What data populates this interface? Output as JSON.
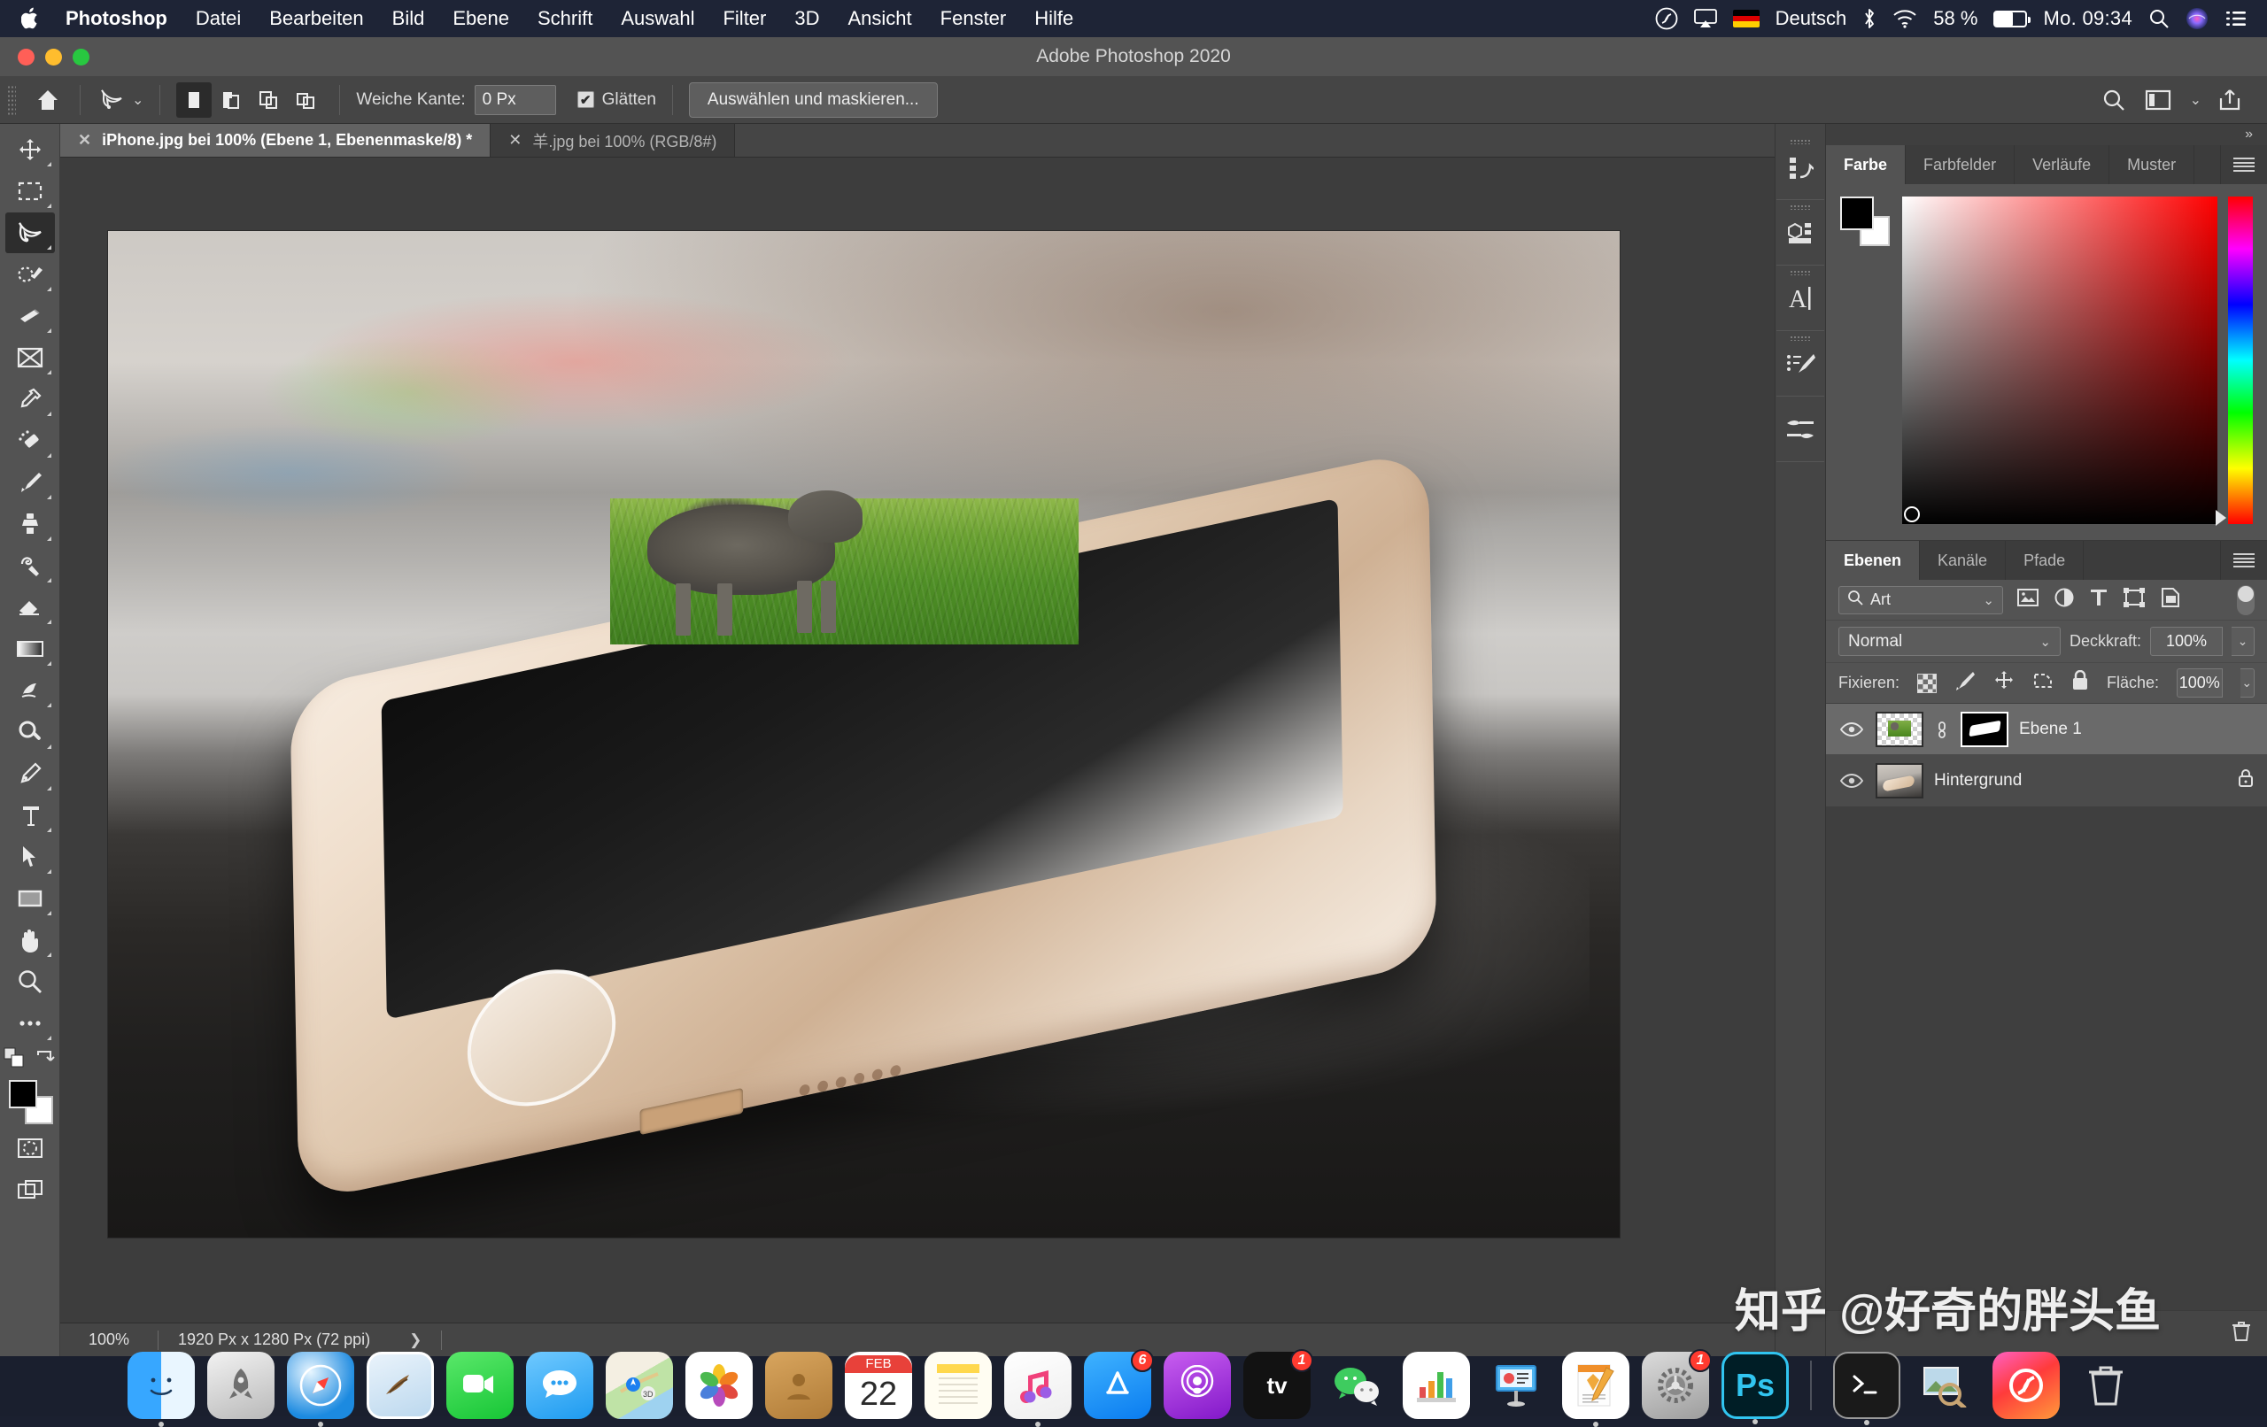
{
  "menubar": {
    "apple_icon": "apple-logo-icon",
    "items": [
      "Photoshop",
      "Datei",
      "Bearbeiten",
      "Bild",
      "Ebene",
      "Schrift",
      "Auswahl",
      "Filter",
      "3D",
      "Ansicht",
      "Fenster",
      "Hilfe"
    ],
    "status": {
      "creative_cloud_icon": "creative-cloud-icon",
      "airplay_icon": "airplay-icon",
      "flag_icon": "german-flag-icon",
      "language": "Deutsch",
      "bluetooth_icon": "bluetooth-icon",
      "wifi_icon": "wifi-icon",
      "battery_percent": "58 %",
      "battery_icon": "battery-icon",
      "clock": "Mo. 09:34",
      "search_icon": "spotlight-search-icon",
      "siri_icon": "siri-icon",
      "control_center_icon": "control-center-icon"
    }
  },
  "window": {
    "title": "Adobe Photoshop 2020",
    "close_label": "",
    "minimize_label": "",
    "zoom_label": ""
  },
  "options_bar": {
    "home_icon": "home-icon",
    "tool_icon": "lasso-tool-icon",
    "tool_preset_chevron": "chevron-down-icon",
    "selection_modes": [
      {
        "name": "new-selection",
        "icon": "new-selection-icon",
        "active": true
      },
      {
        "name": "add-to-selection",
        "icon": "add-selection-icon",
        "active": false
      },
      {
        "name": "subtract-from-selection",
        "icon": "subtract-selection-icon",
        "active": false
      },
      {
        "name": "intersect-selection",
        "icon": "intersect-selection-icon",
        "active": false
      }
    ],
    "feather_label": "Weiche Kante:",
    "feather_value": "0 Px",
    "antialias_label": "Glätten",
    "antialias_checked": true,
    "select_mask_button": "Auswählen und maskieren...",
    "right_icons": [
      "search-icon",
      "workspace-icon",
      "chevron-down-icon",
      "share-icon"
    ]
  },
  "toolbar": {
    "tools": [
      {
        "name": "move-tool",
        "icon": "move-icon",
        "active": false
      },
      {
        "name": "rectangular-marquee-tool",
        "icon": "marquee-icon",
        "active": false
      },
      {
        "name": "lasso-tool",
        "icon": "lasso-icon",
        "active": true
      },
      {
        "name": "quick-selection-tool",
        "icon": "quick-selection-icon",
        "active": false
      },
      {
        "name": "crop-tool",
        "icon": "crop-icon",
        "active": false
      },
      {
        "name": "frame-tool",
        "icon": "frame-icon",
        "active": false
      },
      {
        "name": "eyedropper-tool",
        "icon": "eyedropper-icon",
        "active": false
      },
      {
        "name": "spot-healing-brush-tool",
        "icon": "healing-brush-icon",
        "active": false
      },
      {
        "name": "brush-tool",
        "icon": "brush-icon",
        "active": false
      },
      {
        "name": "clone-stamp-tool",
        "icon": "clone-stamp-icon",
        "active": false
      },
      {
        "name": "history-brush-tool",
        "icon": "history-brush-icon",
        "active": false
      },
      {
        "name": "eraser-tool",
        "icon": "eraser-icon",
        "active": false
      },
      {
        "name": "gradient-tool",
        "icon": "gradient-icon",
        "active": false
      },
      {
        "name": "blur-tool",
        "icon": "blur-icon",
        "active": false
      },
      {
        "name": "dodge-tool",
        "icon": "dodge-icon",
        "active": false
      },
      {
        "name": "pen-tool",
        "icon": "pen-icon",
        "active": false
      },
      {
        "name": "type-tool",
        "icon": "type-icon",
        "active": false
      },
      {
        "name": "path-selection-tool",
        "icon": "path-selection-icon",
        "active": false
      },
      {
        "name": "rectangle-tool",
        "icon": "rectangle-icon",
        "active": false
      },
      {
        "name": "hand-tool",
        "icon": "hand-icon",
        "active": false
      },
      {
        "name": "zoom-tool",
        "icon": "zoom-icon",
        "active": false
      },
      {
        "name": "edit-toolbar",
        "icon": "ellipsis-icon",
        "active": false
      }
    ],
    "foreground_color": "#000000",
    "background_color": "#ffffff",
    "default_colors_icon": "default-colors-icon",
    "swap_colors_icon": "swap-colors-icon",
    "quick_mask_icon": "quick-mask-icon",
    "screen_mode_icon": "screen-mode-icon"
  },
  "tabs": [
    {
      "label": "iPhone.jpg bei 100% (Ebene 1, Ebenenmaske/8) *",
      "active": true,
      "close_icon": "close-icon"
    },
    {
      "label": "羊.jpg bei 100% (RGB/8#)",
      "active": false,
      "close_icon": "close-icon"
    }
  ],
  "statusbar": {
    "zoom": "100%",
    "dimensions": "1920 Px x 1280 Px (72 ppi)",
    "expand_icon": "chevron-right-icon",
    "trash_icon": "trash-icon"
  },
  "mini_dock": {
    "items": [
      {
        "name": "history-panel-icon",
        "icon": "history-icon"
      },
      {
        "name": "3d-panel-icon",
        "icon": "3d-icon"
      },
      {
        "name": "character-panel-icon",
        "icon": "character-icon"
      },
      {
        "name": "brush-settings-panel-icon",
        "icon": "brush-settings-icon"
      },
      {
        "name": "brush-presets-panel-icon",
        "icon": "brush-presets-icon"
      }
    ]
  },
  "panels": {
    "collapse_icon": "collapse-panels-icon",
    "color_group": {
      "tabs": [
        "Farbe",
        "Farbfelder",
        "Verläufe",
        "Muster"
      ],
      "active_tab": "Farbe",
      "menu_icon": "panel-menu-icon",
      "foreground_color": "#000000",
      "background_color": "#ffffff",
      "spectrum_base_hue": "#ff0000"
    },
    "layers_group": {
      "tabs": [
        "Ebenen",
        "Kanäle",
        "Pfade"
      ],
      "active_tab": "Ebenen",
      "menu_icon": "panel-menu-icon",
      "filter_kind": "Art",
      "filter_search_icon": "search-icon",
      "filter_chevron": "chevron-down-icon",
      "filter_icons": [
        "pixel-filter-icon",
        "adjustment-filter-icon",
        "type-filter-icon",
        "shape-filter-icon",
        "smart-object-filter-icon"
      ],
      "filter_toggle": "filter-enable-toggle",
      "blend_mode": "Normal",
      "opacity_label": "Deckkraft:",
      "opacity_value": "100%",
      "lock_label": "Fixieren:",
      "lock_icons": [
        "lock-transparent-pixels-icon",
        "lock-image-pixels-icon",
        "lock-position-icon",
        "lock-artboard-icon",
        "lock-all-icon"
      ],
      "fill_label": "Fläche:",
      "fill_value": "100%",
      "layers": [
        {
          "name": "Ebene 1",
          "visible": true,
          "eye_icon": "eye-icon",
          "has_mask": true,
          "link_icon": "link-mask-icon",
          "selected": true,
          "locked": false
        },
        {
          "name": "Hintergrund",
          "visible": true,
          "eye_icon": "eye-icon",
          "has_mask": false,
          "selected": false,
          "locked": true,
          "lock_icon": "lock-icon"
        }
      ]
    }
  },
  "dock": {
    "items": [
      {
        "name": "finder",
        "running": true,
        "badge": null
      },
      {
        "name": "launchpad",
        "running": false,
        "badge": null
      },
      {
        "name": "safari",
        "running": true,
        "badge": null
      },
      {
        "name": "mail",
        "running": false,
        "badge": null
      },
      {
        "name": "facetime",
        "running": false,
        "badge": null
      },
      {
        "name": "messages",
        "running": false,
        "badge": null
      },
      {
        "name": "maps",
        "running": false,
        "badge": null
      },
      {
        "name": "photos",
        "running": false,
        "badge": null
      },
      {
        "name": "contacts",
        "running": false,
        "badge": null
      },
      {
        "name": "calendar",
        "running": false,
        "badge": null,
        "date": "22",
        "month": "FEB"
      },
      {
        "name": "notes",
        "running": false,
        "badge": null
      },
      {
        "name": "music",
        "running": true,
        "badge": null
      },
      {
        "name": "app-store",
        "running": false,
        "badge": "6"
      },
      {
        "name": "podcasts",
        "running": false,
        "badge": null
      },
      {
        "name": "apple-tv",
        "running": false,
        "badge": "1"
      },
      {
        "name": "wechat",
        "running": false,
        "badge": null
      },
      {
        "name": "numbers",
        "running": false,
        "badge": null
      },
      {
        "name": "keynote",
        "running": false,
        "badge": null
      },
      {
        "name": "pages",
        "running": true,
        "badge": null
      },
      {
        "name": "system-preferences",
        "running": false,
        "badge": "1"
      },
      {
        "name": "photoshop",
        "running": true,
        "badge": null
      },
      {
        "name": "terminal",
        "running": true,
        "badge": null
      },
      {
        "name": "preview",
        "running": false,
        "badge": null
      },
      {
        "name": "creative-cloud",
        "running": false,
        "badge": null
      },
      {
        "name": "trash",
        "running": false,
        "badge": null
      }
    ]
  },
  "watermark": {
    "text": "知乎 @好奇的胖头鱼"
  }
}
